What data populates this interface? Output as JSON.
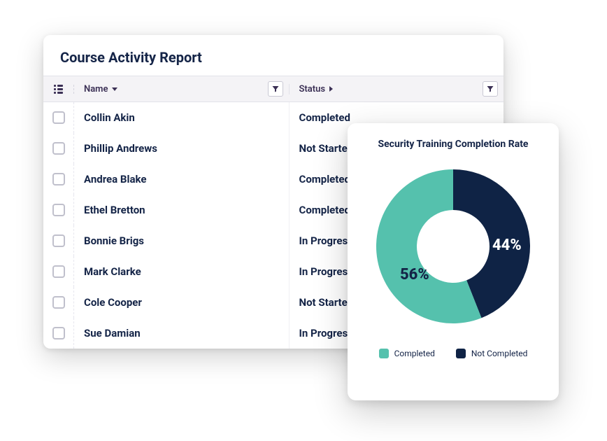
{
  "report": {
    "title": "Course Activity Report",
    "columns": {
      "name": "Name",
      "status": "Status"
    },
    "rows": [
      {
        "name": "Collin Akin",
        "status": "Completed"
      },
      {
        "name": "Phillip Andrews",
        "status": "Not Started"
      },
      {
        "name": "Andrea Blake",
        "status": "Completed"
      },
      {
        "name": "Ethel Bretton",
        "status": "Completed"
      },
      {
        "name": "Bonnie Brigs",
        "status": "In Progress"
      },
      {
        "name": "Mark Clarke",
        "status": "In Progress"
      },
      {
        "name": "Cole Cooper",
        "status": "Not Started"
      },
      {
        "name": "Sue Damian",
        "status": "In Progress"
      }
    ]
  },
  "chart_data": {
    "type": "pie",
    "title": "Security Training Completion Rate",
    "series": [
      {
        "name": "Completed",
        "value": 56,
        "label": "56%",
        "color": "#55c1ad"
      },
      {
        "name": "Not Completed",
        "value": 44,
        "label": "44%",
        "color": "#0f2345"
      }
    ],
    "legend": {
      "completed": "Completed",
      "not_completed": "Not Completed"
    }
  }
}
